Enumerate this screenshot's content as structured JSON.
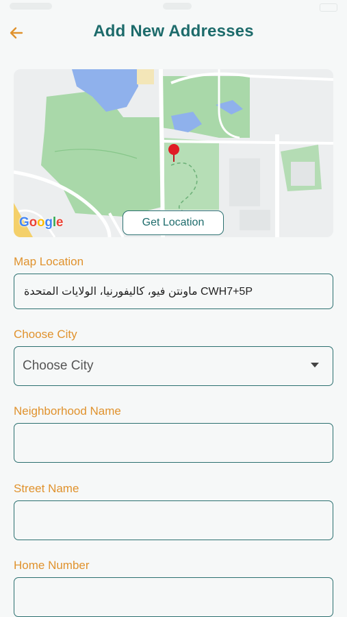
{
  "header": {
    "title": "Add New Addresses",
    "back_icon": "arrow-left-icon"
  },
  "map": {
    "provider_logo": "Google",
    "pin_icon": "map-pin-icon",
    "get_location_label": "Get Location"
  },
  "form": {
    "map_location": {
      "label": "Map Location",
      "value": "ماونتن فيو، كاليفورنيا، الولايات المتحدة CWH7+5P"
    },
    "city": {
      "label": "Choose City",
      "selected": "Choose City"
    },
    "neighborhood": {
      "label": "Neighborhood Name",
      "value": ""
    },
    "street": {
      "label": "Street Name",
      "value": ""
    },
    "home_number": {
      "label": "Home Number",
      "value": ""
    }
  },
  "colors": {
    "accent": "#e0922d",
    "primary": "#1d6b6b",
    "park_green": "#a9d8a9",
    "water_blue": "#8fb1ec",
    "pin_red": "#e01b24"
  }
}
